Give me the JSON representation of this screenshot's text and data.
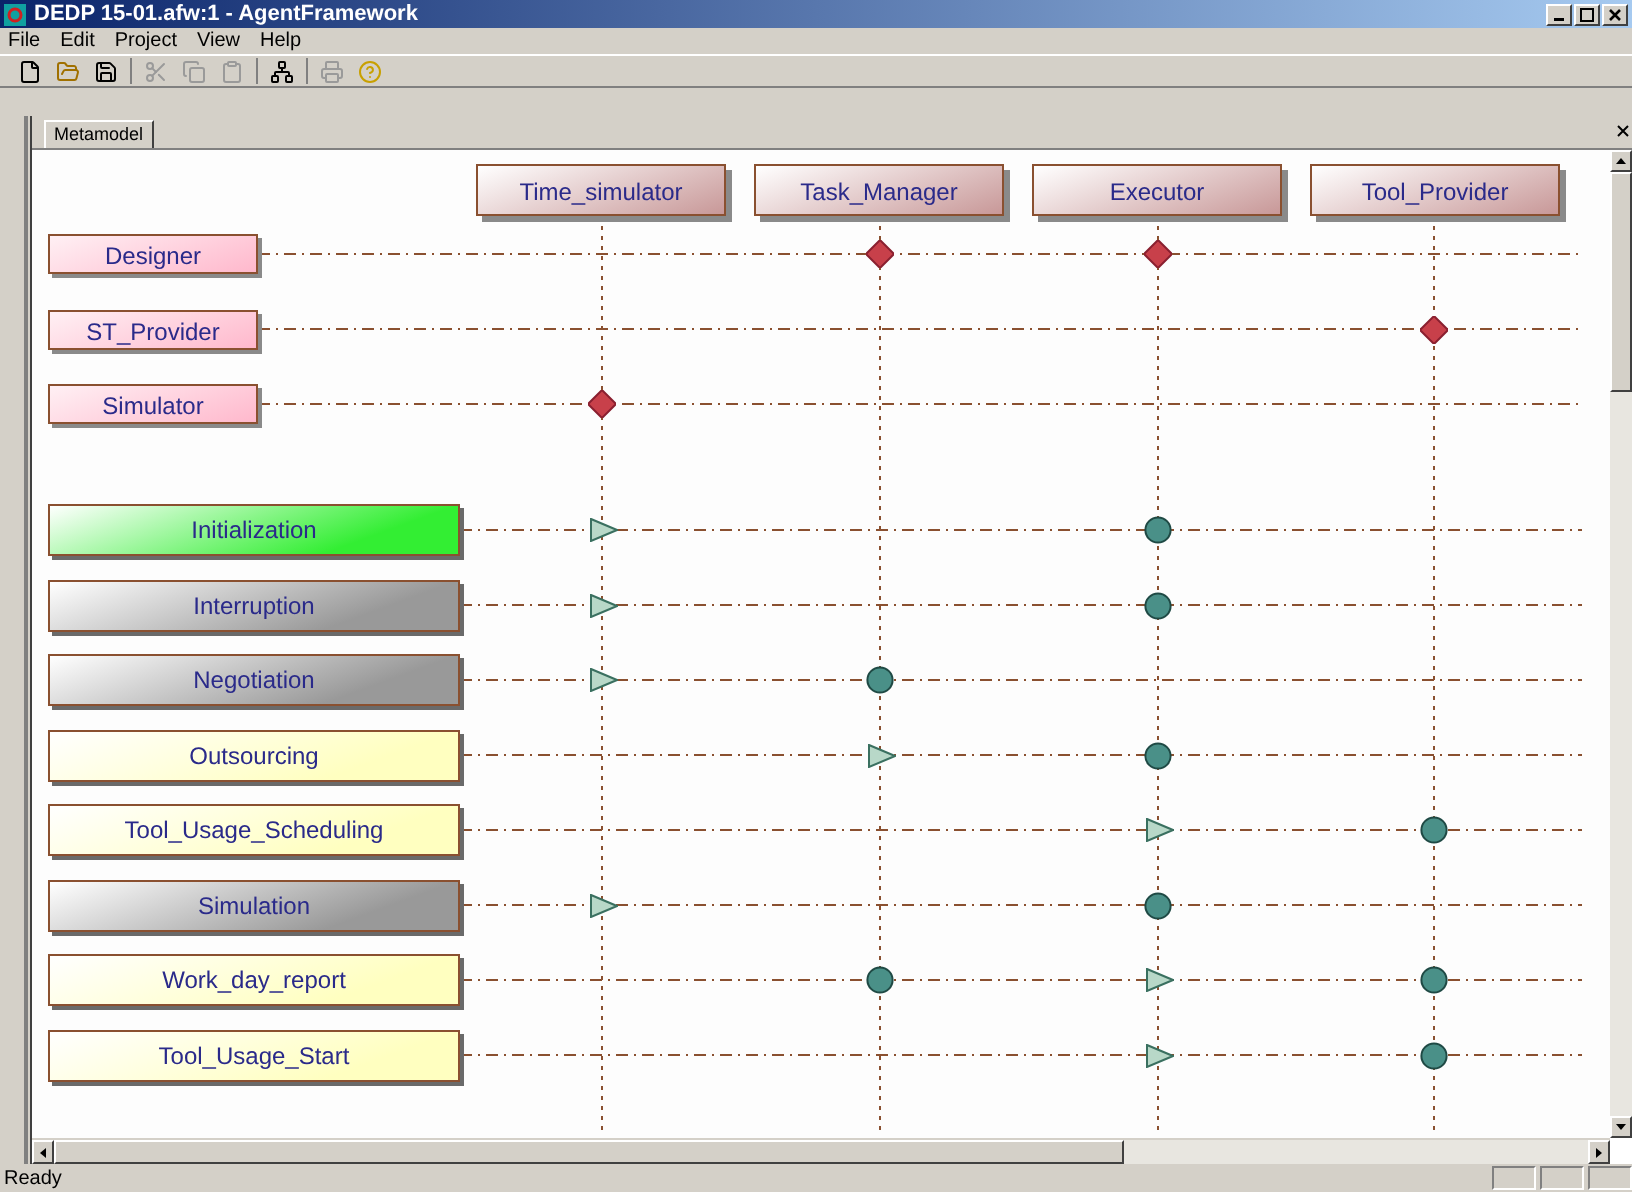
{
  "window": {
    "title": "DEDP 15-01.afw:1 - AgentFramework"
  },
  "menu": [
    "File",
    "Edit",
    "Project",
    "View",
    "Help"
  ],
  "toolbar": [
    {
      "kind": "new",
      "disabled": false
    },
    {
      "kind": "open",
      "disabled": false
    },
    {
      "kind": "save",
      "disabled": false
    },
    {
      "kind": "cut",
      "disabled": true
    },
    {
      "kind": "copy",
      "disabled": true
    },
    {
      "kind": "paste",
      "disabled": true
    },
    {
      "kind": "network",
      "disabled": false
    },
    {
      "kind": "print",
      "disabled": true
    },
    {
      "kind": "help",
      "disabled": false
    }
  ],
  "tabs": [
    {
      "label": "Metamodel",
      "selected": true
    }
  ],
  "columns": [
    "Time_simulator",
    "Task_Manager",
    "Executor",
    "Tool_Provider"
  ],
  "roles": [
    {
      "label": "Designer",
      "markers": [
        {
          "kind": "none"
        },
        {
          "kind": "diamond"
        },
        {
          "kind": "diamond"
        },
        {
          "kind": "none"
        }
      ]
    },
    {
      "label": "ST_Provider",
      "markers": [
        {
          "kind": "none"
        },
        {
          "kind": "none"
        },
        {
          "kind": "none"
        },
        {
          "kind": "diamond"
        }
      ]
    },
    {
      "label": "Simulator",
      "markers": [
        {
          "kind": "diamond"
        },
        {
          "kind": "none"
        },
        {
          "kind": "none"
        },
        {
          "kind": "none"
        }
      ]
    }
  ],
  "protocols": [
    {
      "label": "Initialization",
      "color": "#33ee33",
      "markers": [
        {
          "kind": "triangle"
        },
        {
          "kind": "none"
        },
        {
          "kind": "circle"
        },
        {
          "kind": "none"
        }
      ]
    },
    {
      "label": "Interruption",
      "color": "#999999",
      "markers": [
        {
          "kind": "triangle"
        },
        {
          "kind": "none"
        },
        {
          "kind": "circle"
        },
        {
          "kind": "none"
        }
      ]
    },
    {
      "label": "Negotiation",
      "color": "#999999",
      "markers": [
        {
          "kind": "triangle"
        },
        {
          "kind": "circle"
        },
        {
          "kind": "none"
        },
        {
          "kind": "none"
        }
      ]
    },
    {
      "label": "Outsourcing",
      "color": "#ffffc0",
      "markers": [
        {
          "kind": "none"
        },
        {
          "kind": "triangle"
        },
        {
          "kind": "circle"
        },
        {
          "kind": "none"
        }
      ]
    },
    {
      "label": "Tool_Usage_Scheduling",
      "color": "#ffffc0",
      "markers": [
        {
          "kind": "none"
        },
        {
          "kind": "none"
        },
        {
          "kind": "triangle"
        },
        {
          "kind": "circle"
        }
      ]
    },
    {
      "label": "Simulation",
      "color": "#999999",
      "markers": [
        {
          "kind": "triangle"
        },
        {
          "kind": "none"
        },
        {
          "kind": "circle"
        },
        {
          "kind": "none"
        }
      ]
    },
    {
      "label": "Work_day_report",
      "color": "#ffffc0",
      "markers": [
        {
          "kind": "none"
        },
        {
          "kind": "circle"
        },
        {
          "kind": "triangle"
        },
        {
          "kind": "circle"
        }
      ]
    },
    {
      "label": "Tool_Usage_Start",
      "color": "#ffffc0",
      "markers": [
        {
          "kind": "none"
        },
        {
          "kind": "none"
        },
        {
          "kind": "triangle"
        },
        {
          "kind": "circle"
        }
      ]
    }
  ],
  "status_bar": {
    "text": "Ready"
  }
}
